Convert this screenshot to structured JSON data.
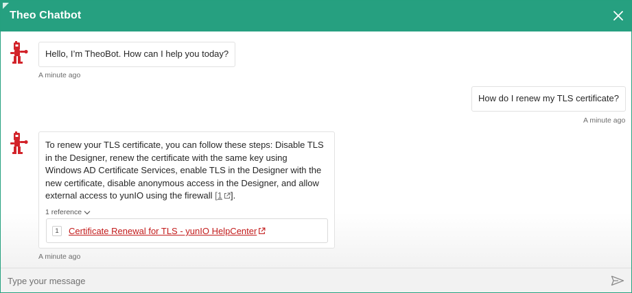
{
  "header": {
    "title": "Theo Chatbot"
  },
  "colors": {
    "brand": "#26a080",
    "link": "#c21a1a",
    "avatar": "#d2232a"
  },
  "messages": [
    {
      "from": "bot",
      "text": "Hello, I’m TheoBot. How can I help you today?",
      "time": "A minute ago"
    },
    {
      "from": "user",
      "text": "How do I renew my TLS certificate?",
      "time": "A minute ago"
    },
    {
      "from": "bot",
      "lines": [
        "To renew your TLS certificate, you can follow these steps: Disable TLS",
        "in the Designer, renew the certificate with the same key using",
        "Windows AD Certificate Services, enable TLS in the Designer with the",
        "new certificate, disable anonymous access in the Designer, and allow",
        "external access to yunIO using the firewall "
      ],
      "citation": "1",
      "text_end": "].",
      "citation_open": "[",
      "reference_toggle": "1 reference",
      "references": [
        {
          "number": "1",
          "title": "Certificate Renewal for TLS - yunIO HelpCenter"
        }
      ],
      "time": "A minute ago"
    }
  ],
  "input": {
    "placeholder": "Type your message"
  },
  "icons": {
    "close": "close-icon",
    "send": "send-icon",
    "avatar": "theo-robot-icon",
    "external": "external-link-icon",
    "chevron": "chevron-down-icon"
  }
}
